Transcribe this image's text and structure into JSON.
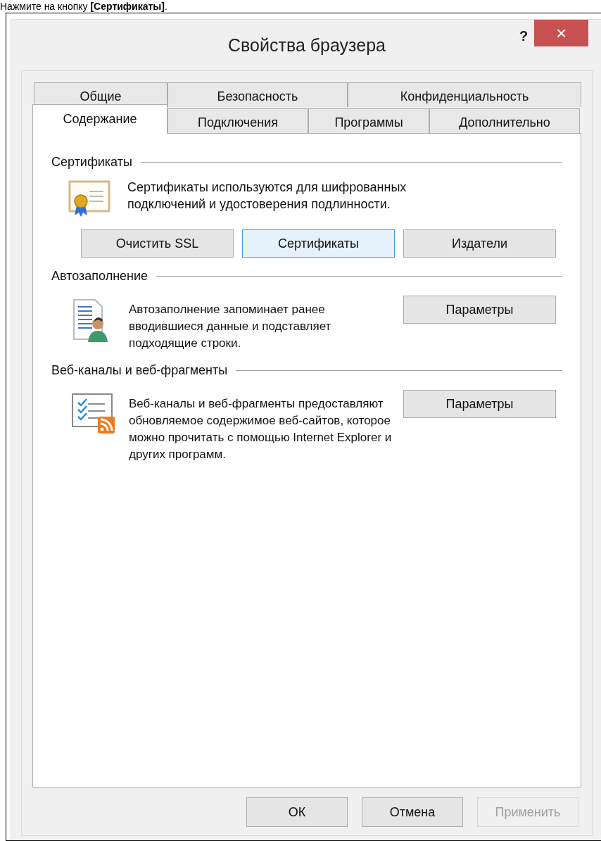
{
  "instruction": "Нажмите на кнопку **[Сертификаты]**.",
  "window": {
    "title": "Свойства браузера",
    "help": "?",
    "close": "×"
  },
  "tab_rows": [
    [
      {
        "label": "Общие",
        "selected": false
      },
      {
        "label": "Безопасность",
        "selected": false
      },
      {
        "label": "Конфиденциальность",
        "selected": false
      }
    ],
    [
      {
        "label": "Содержание",
        "selected": true
      },
      {
        "label": "Подключения",
        "selected": false
      },
      {
        "label": "Программы",
        "selected": false
      },
      {
        "label": "Дополнительно",
        "selected": false
      }
    ]
  ],
  "sections": [
    {
      "kind": "buttons_below",
      "title": "Сертификаты",
      "description": "Сертификаты используются для шифрованных подключений и удостоверения подлинности.",
      "buttons": [
        {
          "label": "Очистить SSL",
          "focused": false
        },
        {
          "label": "Сертификаты",
          "focused": true
        },
        {
          "label": "Издатели",
          "focused": false
        }
      ]
    },
    {
      "kind": "button_beside",
      "title": "Автозаполнение",
      "description": "Автозаполнение запоминает ранее вводившиеся данные и подставляет подходящие строки.",
      "buttons": [
        {
          "label": "Параметры",
          "focused": false
        }
      ]
    },
    {
      "kind": "button_beside",
      "title": "Веб-каналы и веб-фрагменты",
      "description": "Веб-каналы и веб-фрагменты предоставляют обновляемое содержимое веб-сайтов, которое можно прочитать с помощью Internet Explorer и других программ.",
      "buttons": [
        {
          "label": "Параметры",
          "focused": false
        }
      ]
    }
  ],
  "footer_buttons": [
    {
      "label": "ОК",
      "disabled": false
    },
    {
      "label": "Отмена",
      "disabled": false
    },
    {
      "label": "Применить",
      "disabled": true
    }
  ]
}
